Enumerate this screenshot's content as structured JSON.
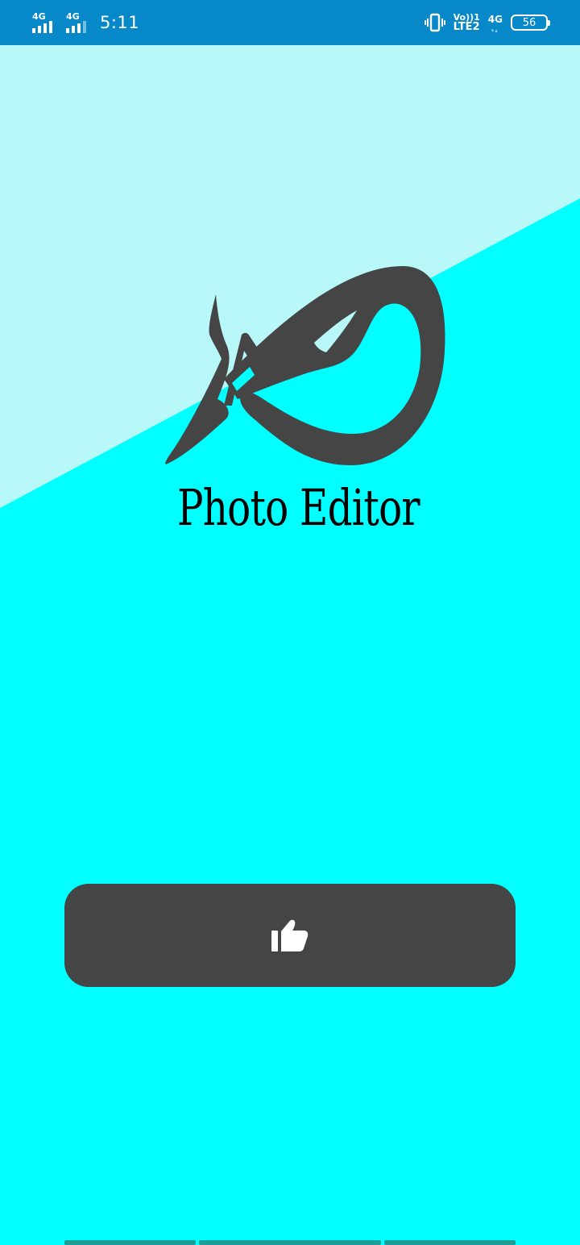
{
  "status_bar": {
    "sim1_network": "4G",
    "sim2_network": "4G",
    "time": "5:11",
    "volte_top": "Vo))1",
    "volte_bottom": "LTE2",
    "data_network": "4G",
    "battery_level": "56",
    "vibrate_icon": "vibrate-icon"
  },
  "logo": {
    "text": "Photo Editor",
    "icon": "swirl-logo-icon"
  },
  "like_button": {
    "icon": "thumbs-up-icon"
  },
  "colors": {
    "status_bar": "#0788c9",
    "background_light": "#b8f8f8",
    "background_main": "#00ffff",
    "button": "#454545",
    "logo_mark": "#454545",
    "tab_indicator": "#1a9e98"
  }
}
